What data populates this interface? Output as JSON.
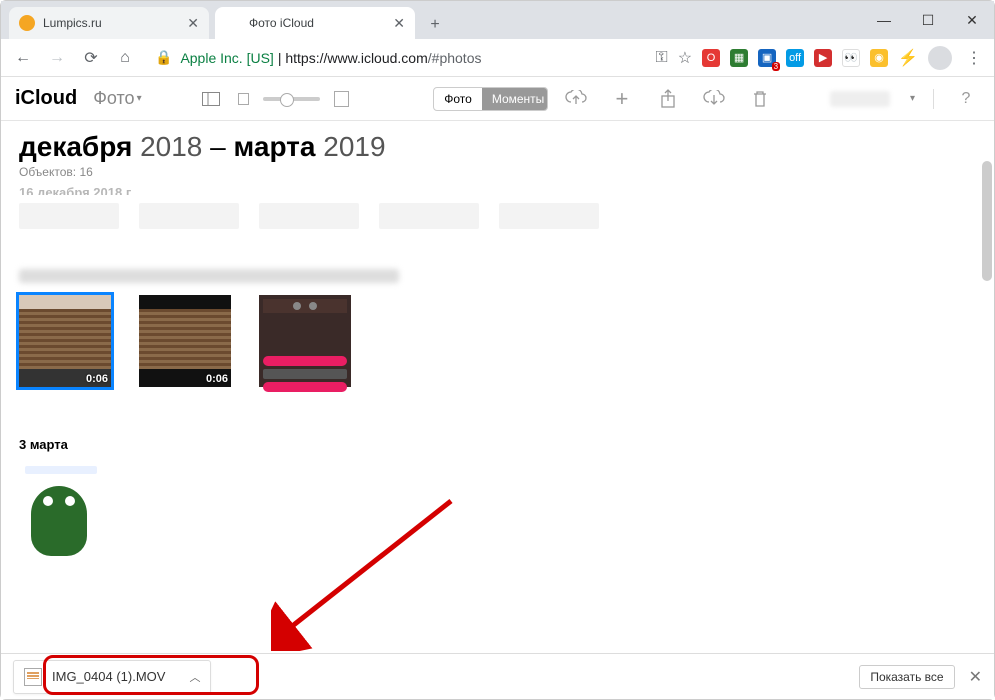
{
  "tabs": [
    {
      "title": "Lumpics.ru",
      "favicon_color": "#f5a623"
    },
    {
      "title": "Фото iCloud",
      "favicon_color": "#999"
    }
  ],
  "address": {
    "company": "Apple Inc. [US]",
    "separator": " | ",
    "protocol": "https://",
    "host": "www.icloud.com",
    "path": "/#photos"
  },
  "icloud": {
    "brand": "iCloud",
    "section": "Фото",
    "segmented": {
      "photos": "Фото",
      "moments": "Моменты"
    }
  },
  "page": {
    "title_month1": "декабря",
    "title_year1": "2018",
    "title_sep": " – ",
    "title_month2": "марта",
    "title_year2": "2019",
    "subhead": "Объектов: 16",
    "section_date_top": "16 декабря 2018 г.",
    "thumbs": [
      {
        "duration": "0:06"
      },
      {
        "duration": "0:06"
      },
      {
        "duration": ""
      }
    ],
    "section_date_2": "3 марта"
  },
  "download": {
    "filename": "IMG_0404 (1).MOV",
    "show_all": "Показать все"
  }
}
